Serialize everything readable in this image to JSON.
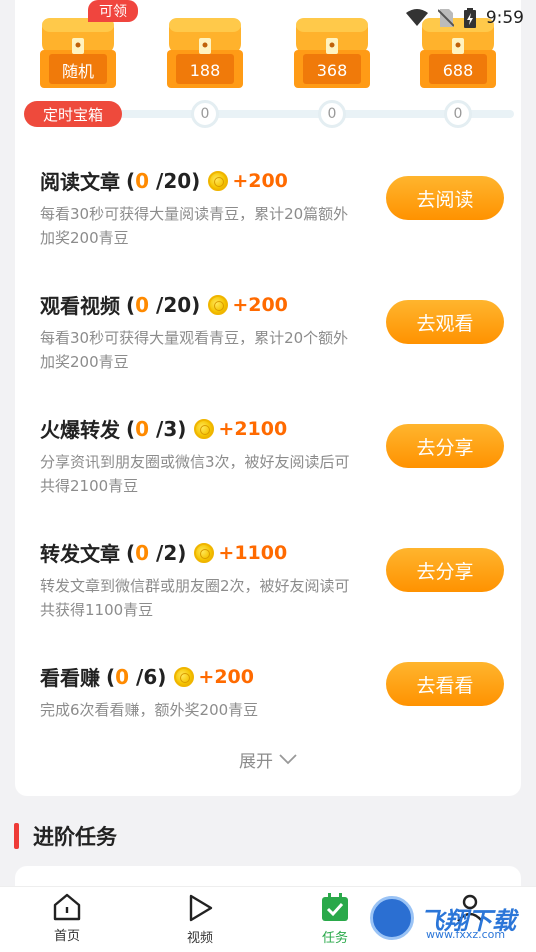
{
  "status_bar": {
    "time": "9:59"
  },
  "chests": [
    {
      "label": "随机"
    },
    {
      "label": "188"
    },
    {
      "label": "368"
    },
    {
      "label": "688"
    }
  ],
  "chest_badge": "可领",
  "timer_label": "定时宝箱",
  "progress_nodes": [
    "0",
    "0",
    "0"
  ],
  "tasks": [
    {
      "title": "阅读文章",
      "done": "0",
      "total": "/20",
      "reward": "+200",
      "desc": "每看30秒可获得大量阅读青豆，累计20篇额外加奖200青豆",
      "button": "去阅读"
    },
    {
      "title": "观看视频",
      "done": "0",
      "total": "/20",
      "reward": "+200",
      "desc": "每看30秒可获得大量观看青豆，累计20个额外加奖200青豆",
      "button": "去观看"
    },
    {
      "title": "火爆转发",
      "done": "0",
      "total": "/3",
      "reward": "+2100",
      "desc": "分享资讯到朋友圈或微信3次，被好友阅读后可共得2100青豆",
      "button": "去分享"
    },
    {
      "title": "转发文章",
      "done": "0",
      "total": "/2",
      "reward": "+1100",
      "desc": "转发文章到微信群或朋友圈2次，被好友阅读可共获得1100青豆",
      "button": "去分享"
    },
    {
      "title": "看看赚",
      "done": "0",
      "total": "/6",
      "reward": "+200",
      "desc": "完成6次看看赚，额外奖200青豆",
      "button": "去看看"
    }
  ],
  "expand_label": "展开",
  "section_title": "进阶任务",
  "tabbar": [
    {
      "label": "首页",
      "icon": "home-icon"
    },
    {
      "label": "视频",
      "icon": "play-icon"
    },
    {
      "label": "任务",
      "icon": "task-icon"
    },
    {
      "label": "",
      "icon": "profile-icon"
    }
  ],
  "watermark": {
    "text": "飞翔下载",
    "sub": "www.fxxz.com"
  },
  "colors": {
    "accent": "#ff9200",
    "red": "#ee4a3c",
    "green": "#2aa94a"
  }
}
